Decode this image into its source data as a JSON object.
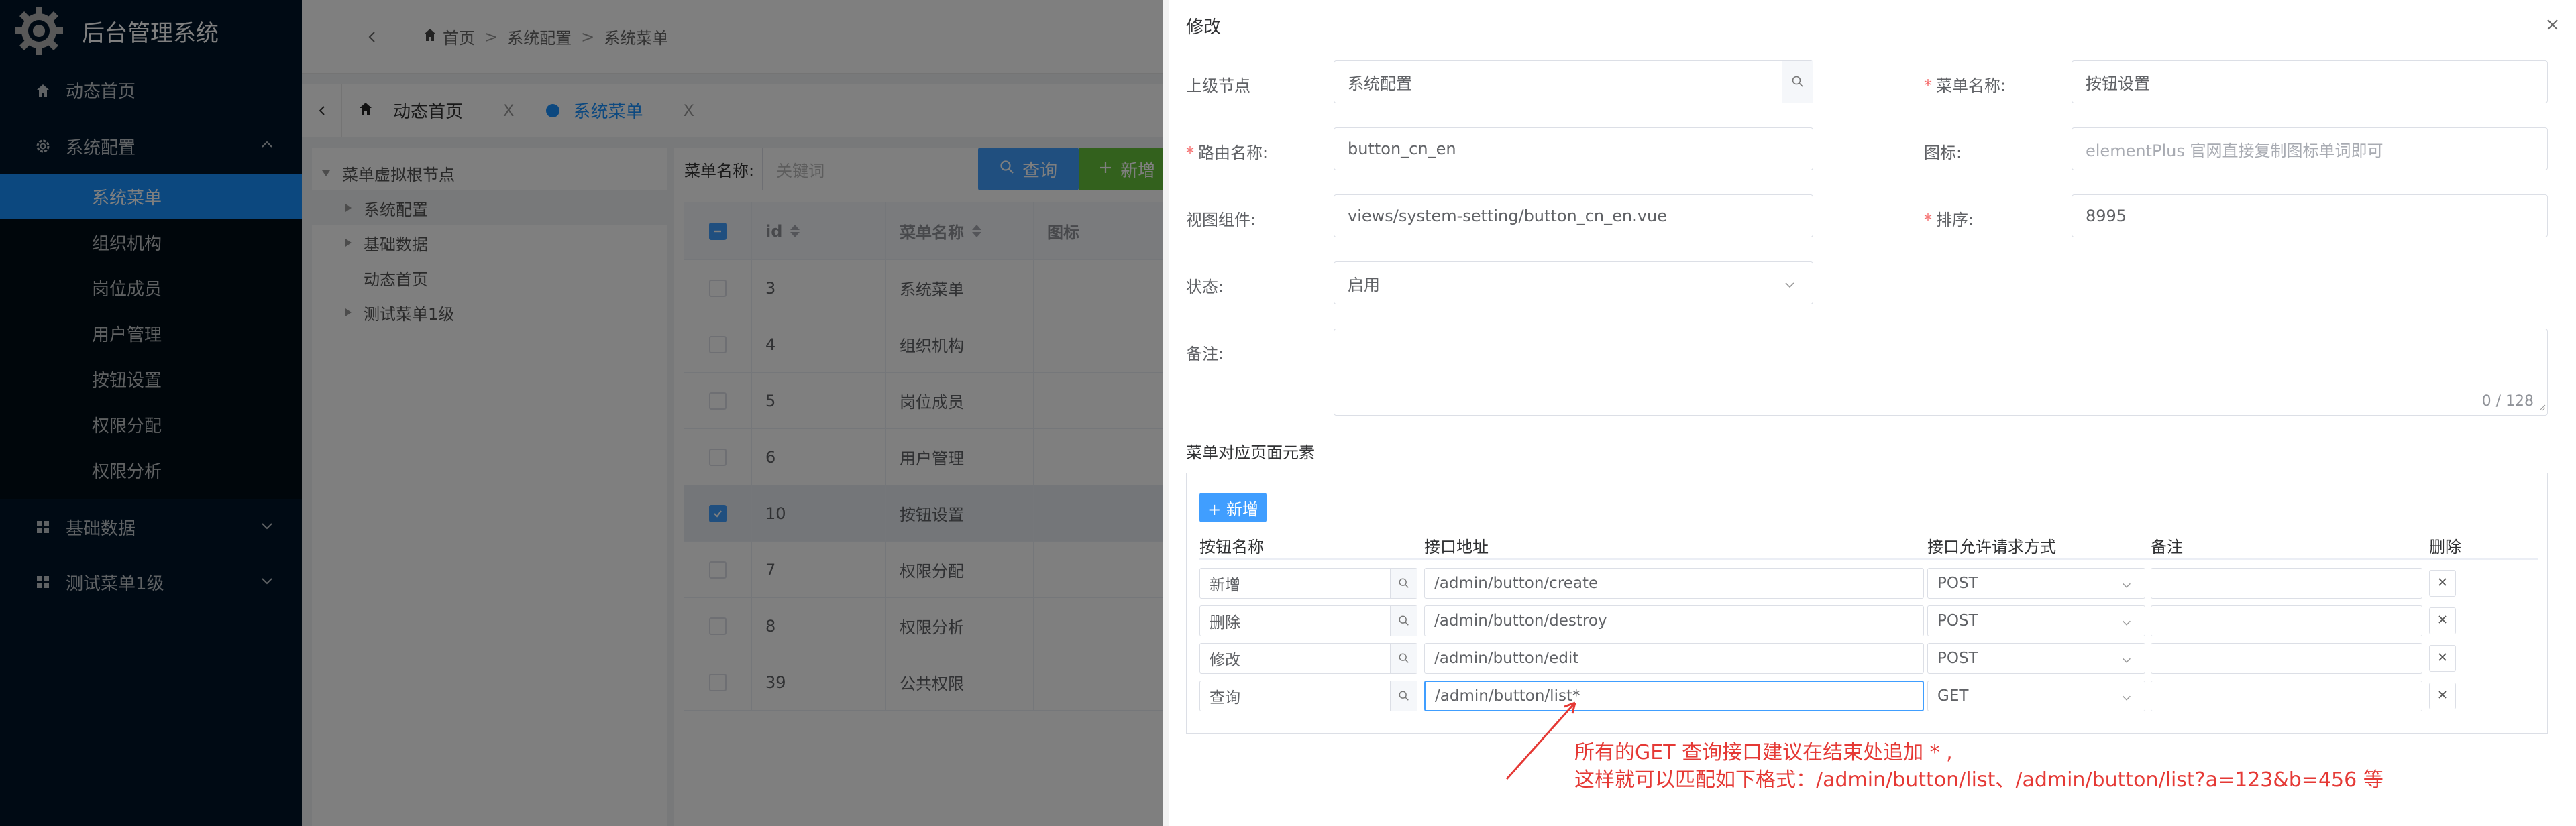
{
  "app": {
    "title": "后台管理系统"
  },
  "sidebar": {
    "items": [
      {
        "label": "动态首页",
        "icon": "home-icon"
      },
      {
        "label": "系统配置",
        "icon": "gear-icon",
        "expanded": true,
        "children": [
          "系统菜单",
          "组织机构",
          "岗位成员",
          "用户管理",
          "按钮设置",
          "权限分配",
          "权限分析"
        ],
        "active_child": "系统菜单"
      },
      {
        "label": "基础数据",
        "icon": "grid-icon"
      },
      {
        "label": "测试菜单1级",
        "icon": "grid-icon"
      }
    ]
  },
  "breadcrumb": [
    "首页",
    "系统配置",
    "系统菜单"
  ],
  "tabs": [
    {
      "label": "动态首页",
      "close": "X"
    },
    {
      "label": "系统菜单",
      "close": "X",
      "active": true
    }
  ],
  "tree": {
    "root": "菜单虚拟根节点",
    "nodes": [
      "系统配置",
      "基础数据",
      "动态首页",
      "测试菜单1级"
    ]
  },
  "search": {
    "label": "菜单名称:",
    "placeholder": "关键词",
    "query_label": "查询",
    "add_label": "新增"
  },
  "table": {
    "columns": [
      "id",
      "菜单名称",
      "图标"
    ],
    "rows": [
      {
        "id": "3",
        "name": "系统菜单",
        "checked": false
      },
      {
        "id": "4",
        "name": "组织机构",
        "checked": false
      },
      {
        "id": "5",
        "name": "岗位成员",
        "checked": false
      },
      {
        "id": "6",
        "name": "用户管理",
        "checked": false
      },
      {
        "id": "10",
        "name": "按钮设置",
        "checked": true
      },
      {
        "id": "7",
        "name": "权限分配",
        "checked": false
      },
      {
        "id": "8",
        "name": "权限分析",
        "checked": false
      },
      {
        "id": "39",
        "name": "公共权限",
        "checked": false
      }
    ]
  },
  "drawer": {
    "title": "修改",
    "form": {
      "parent_label": "上级节点",
      "parent_value": "系统配置",
      "name_label": "菜单名称:",
      "name_value": "按钮设置",
      "route_label": "路由名称:",
      "route_value": "button_cn_en",
      "icon_label": "图标:",
      "icon_placeholder": "elementPlus 官网直接复制图标单词即可",
      "view_label": "视图组件:",
      "view_value": "views/system-setting/button_cn_en.vue",
      "sort_label": "排序:",
      "sort_value": "8995",
      "status_label": "状态:",
      "status_value": "启用",
      "remark_label": "备注:",
      "remark_counter": "0 / 128"
    },
    "elements": {
      "title": "菜单对应页面元素",
      "new_label": "+ 新增",
      "columns": [
        "按钮名称",
        "接口地址",
        "接口允许请求方式",
        "备注",
        "删除"
      ],
      "rows": [
        {
          "name": "新增",
          "url": "/admin/button/create",
          "method": "POST",
          "remark": ""
        },
        {
          "name": "删除",
          "url": "/admin/button/destroy",
          "method": "POST",
          "remark": ""
        },
        {
          "name": "修改",
          "url": "/admin/button/edit",
          "method": "POST",
          "remark": ""
        },
        {
          "name": "查询",
          "url": "/admin/button/list*",
          "method": "GET",
          "remark": ""
        }
      ]
    }
  },
  "annotation": {
    "line1": "所有的GET 查询接口建议在结束处追加 * ,",
    "line2": "这样就可以匹配如下格式：/admin/button/list、/admin/button/list?a=123&b=456 等",
    "color": "#e53935"
  }
}
